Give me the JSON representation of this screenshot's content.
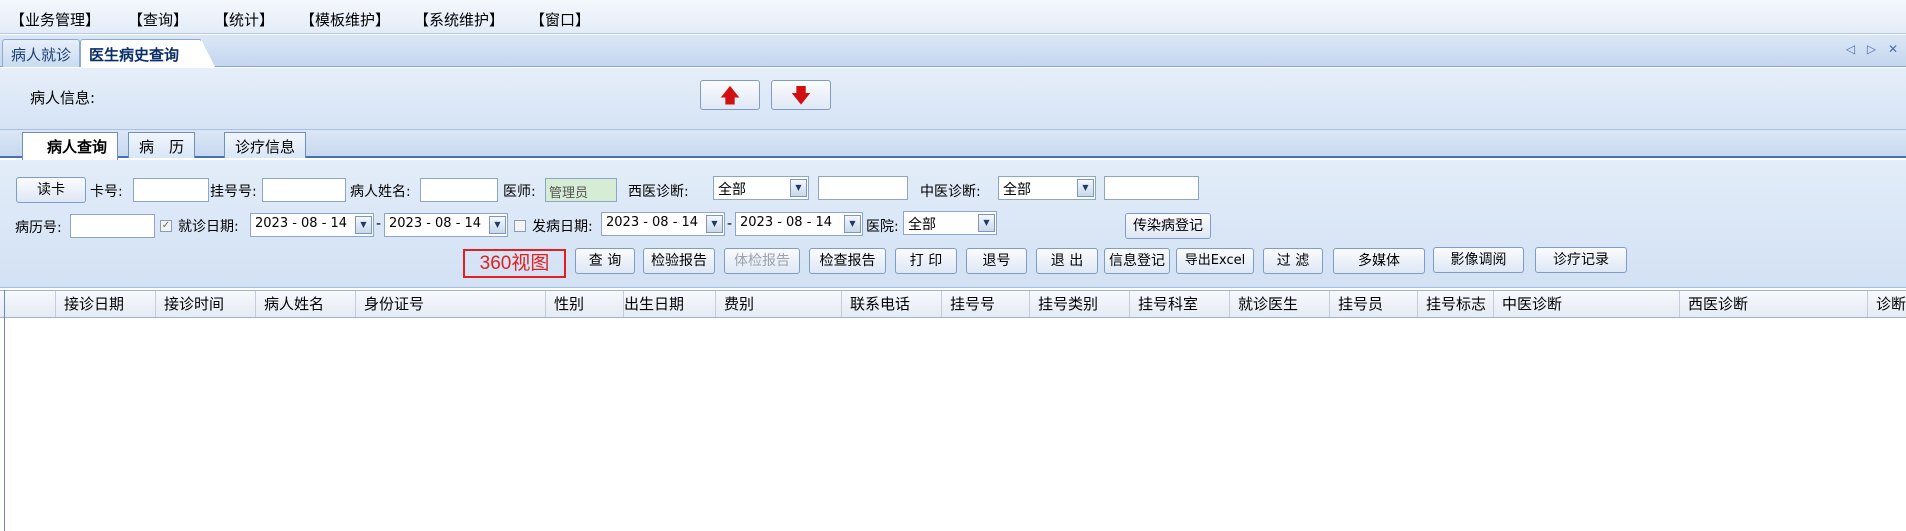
{
  "menu": [
    "【业务管理】",
    "【查询】",
    "【统计】",
    "【模板维护】",
    "【系统维护】",
    "【窗口】"
  ],
  "doc_tabs": [
    "病人就诊",
    "医生病史查询"
  ],
  "tab_nav": "◁ ▷ ✕",
  "patient_info": {
    "label": "病人信息:",
    "up_arrow": "🡅",
    "down_arrow": "🡇"
  },
  "sub_tabs": [
    "病人查询",
    "病　历",
    "诊疗信息"
  ],
  "query": {
    "read_card": "读卡",
    "card_no_label": "卡号:",
    "reg_no_label": "挂号号:",
    "patient_name_label": "病人姓名:",
    "doctor_label": "医师:",
    "doctor_value": "管理员",
    "western_dx_label": "西医诊断:",
    "western_dx_value": "全部",
    "tcm_dx_label": "中医诊断:",
    "tcm_dx_value": "全部",
    "record_no_label": "病历号:",
    "visit_date_label": "就诊日期:",
    "visit_date_from": "2023 - 08 - 14",
    "visit_date_to": "2023 - 08 - 14",
    "dash": "-",
    "onset_date_label": "发病日期:",
    "onset_date_from": "2023 - 08 - 14",
    "onset_date_to": "2023 - 08 - 14",
    "hospital_label": "医院:",
    "hospital_value": "全部",
    "infectious_btn": "传染病登记",
    "view360": "360视图",
    "buttons": [
      "查 询",
      "检验报告",
      "体检报告",
      "检查报告",
      "打 印",
      "退号",
      "退 出",
      "信息登记",
      "导出Excel",
      "过 滤",
      "多媒体",
      "影像调阅",
      "诊疗记录"
    ]
  },
  "grid_columns": [
    "接诊日期",
    "接诊时间",
    "病人姓名",
    "身份证号",
    "性别",
    "出生日期",
    "费别",
    "联系电话",
    "挂号号",
    "挂号类别",
    "挂号科室",
    "就诊医生",
    "挂号员",
    "挂号标志",
    "中医诊断",
    "西医诊断",
    "诊断"
  ]
}
